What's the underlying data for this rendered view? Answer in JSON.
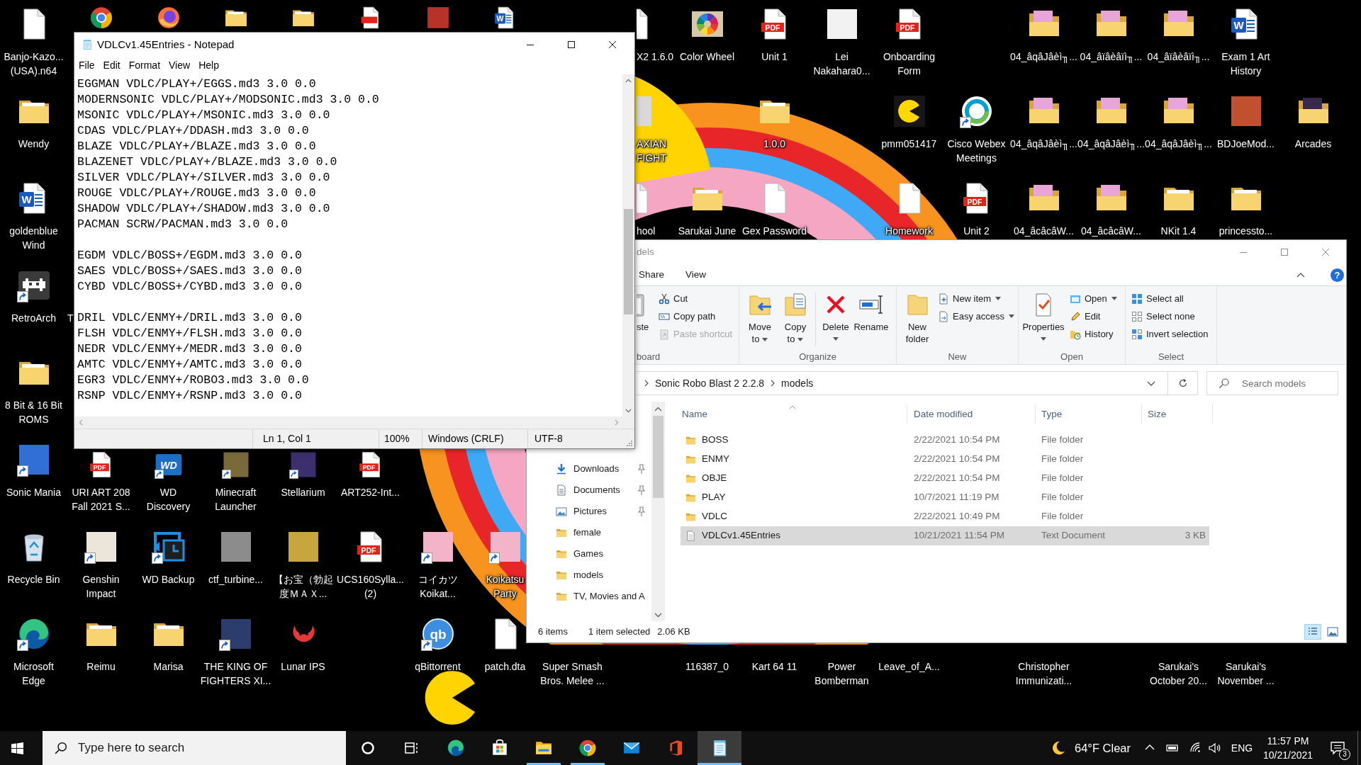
{
  "desktop": {
    "icons": [
      {
        "kind": "file",
        "label": "Banjo-Kazo...\n(USA).n64"
      },
      {
        "kind": "chrome"
      },
      {
        "kind": "firefox"
      },
      {
        "kind": "folder"
      },
      {
        "kind": "folder"
      },
      {
        "kind": "pdf"
      },
      {
        "kind": "picture",
        "color": "#b8322a"
      },
      {
        "kind": "word",
        "icon_text": "W"
      },
      {
        "kind": "file",
        "label": "X2 1.6.0"
      },
      {
        "kind": "colorwheel",
        "label": "Color Wheel"
      },
      {
        "kind": "pdf",
        "icon_text": "PDF",
        "label": "Unit 1"
      },
      {
        "kind": "picture",
        "color": "#f2f2f2",
        "label": "Lei\nNakahara0..."
      },
      {
        "kind": "pdf",
        "icon_text": "PDF",
        "label": "Onboarding\nForm"
      },
      {
        "kind": "imagefolder",
        "color": "#e8a6d6",
        "label": "04_âqâJâèì╖..."
      },
      {
        "kind": "imagefolder",
        "color": "#e8a6d6",
        "label": "04_âïâèâïì╖..."
      },
      {
        "kind": "imagefolder",
        "color": "#e8a6d6",
        "label": "04_âïâèâïì╖..."
      },
      {
        "kind": "word",
        "icon_text": "W",
        "label": "Exam 1 Art\nHistory"
      },
      {
        "kind": "folder",
        "label": "Wendy"
      },
      {
        "kind": "picture",
        "color": "#d9d9d9",
        "label": "AXIAN\nFIGHT"
      },
      {
        "kind": "folder",
        "label": "1.0.0"
      },
      {
        "kind": "pacman",
        "label": "pmm051417"
      },
      {
        "kind": "webex",
        "shortcut": true,
        "label": "Cisco Webex\nMeetings"
      },
      {
        "kind": "imagefolder",
        "color": "#e8a6d6",
        "label": "04_âqâJâèì╖..."
      },
      {
        "kind": "imagefolder",
        "color": "#e8a6d6",
        "label": "04_âqâJâèì╖..."
      },
      {
        "kind": "imagefolder",
        "color": "#e8a6d6",
        "label": "04_âqâJâèì╖..."
      },
      {
        "kind": "picture",
        "color": "#c0502e",
        "label": "BDJoeMod..."
      },
      {
        "kind": "imagefolder",
        "color": "#3a2a4a",
        "label": "Arcades"
      },
      {
        "kind": "word",
        "icon_text": "W",
        "label": "goldenblue\nWind"
      },
      {
        "kind": "file",
        "label": "hool"
      },
      {
        "kind": "folder",
        "label": "Sarukai June"
      },
      {
        "kind": "file",
        "label": "Gex Password"
      },
      {
        "kind": "file",
        "label": "Homework"
      },
      {
        "kind": "pdf",
        "icon_text": "PDF",
        "label": "Unit 2"
      },
      {
        "kind": "imagefolder",
        "color": "#e8a6d6",
        "label": "04_âcâcâW..."
      },
      {
        "kind": "imagefolder",
        "color": "#e8a6d6",
        "label": "04_âcâcâW..."
      },
      {
        "kind": "folder",
        "label": "NKit 1.4"
      },
      {
        "kind": "folder",
        "label": "princessto..."
      },
      {
        "kind": "retroarch",
        "shortcut": true,
        "label": "RetroArch"
      },
      {
        "label": "T"
      },
      {
        "kind": "folder",
        "label": "8 Bit & 16 Bit\nROMS"
      },
      {
        "kind": "picture",
        "color": "#2f6fd6",
        "shortcut": true,
        "label": "Sonic Mania"
      },
      {
        "kind": "pdf",
        "icon_text": "PDF",
        "label": "URI ART 208\nFall 2021 S..."
      },
      {
        "kind": "wd",
        "icon_text": "WD",
        "shortcut": true,
        "label": "WD\nDiscovery"
      },
      {
        "kind": "picture",
        "color": "#7a6a3a",
        "shortcut": true,
        "label": "Minecraft\nLauncher"
      },
      {
        "kind": "picture",
        "color": "#3b2f6e",
        "shortcut": true,
        "label": "Stellarium"
      },
      {
        "kind": "pdf",
        "icon_text": "PDF",
        "label": "ART252-Int..."
      },
      {
        "kind": "recyclebin",
        "label": "Recycle Bin"
      },
      {
        "kind": "picture",
        "color": "#ece6da",
        "shortcut": true,
        "label": "Genshin\nImpact"
      },
      {
        "kind": "wdbackup",
        "shortcut": true,
        "label": "WD Backup"
      },
      {
        "kind": "picture",
        "color": "#8c8c8c",
        "label": "ctf_turbine..."
      },
      {
        "kind": "picture",
        "color": "#c7a640",
        "label": "【お宝（勃起度ＭＡＸ..."
      },
      {
        "kind": "pdf",
        "icon_text": "PDF",
        "label": "UCS160Sylla...\n(2)"
      },
      {
        "kind": "picture",
        "color": "#f3b3c8",
        "shortcut": true,
        "label": "コイカツ\nKoikat..."
      },
      {
        "kind": "picture",
        "color": "#f3b3c8",
        "shortcut": true,
        "label": "Koikatsu\nParty"
      },
      {
        "kind": "edge",
        "shortcut": true,
        "label": "Microsoft\nEdge"
      },
      {
        "kind": "folder",
        "label": "Reimu"
      },
      {
        "kind": "folder",
        "label": "Marisa"
      },
      {
        "kind": "picture",
        "color": "#2c3c6c",
        "shortcut": true,
        "label": "THE KING OF\nFIGHTERS XI..."
      },
      {
        "kind": "lunar",
        "label": "Lunar IPS"
      },
      {
        "kind": "qbittorrent",
        "icon_text": "qb",
        "shortcut": true,
        "label": "qBittorrent"
      },
      {
        "kind": "file",
        "label": "patch.dta"
      },
      {
        "label": "Super Smash\nBros. Melee ..."
      },
      {
        "label": "116387_0"
      },
      {
        "label": "Kart 64 11"
      },
      {
        "label": "Power\nBomberman"
      },
      {
        "label": "Leave_of_A..."
      },
      {
        "label": "Christopher\nImmunizati..."
      },
      {
        "label": "Sarukai's\nOctober 20..."
      },
      {
        "label": "Sarukai's\nNovember ..."
      }
    ]
  },
  "notepad": {
    "title": "VDLCv1.45Entries - Notepad",
    "menu": [
      "File",
      "Edit",
      "Format",
      "View",
      "Help"
    ],
    "blocks": [
      [
        "EGGMAN VDLC/PLAY+/EGGS.md3 3.0 0.0",
        "MODERNSONIC VDLC/PLAY+/MODSONIC.md3 3.0 0.0",
        "MSONIC VDLC/PLAY+/MSONIC.md3 3.0 0.0",
        "CDAS VDLC/PLAY+/DDASH.md3 3.0 0.0",
        "BLAZE VDLC/PLAY+/BLAZE.md3 3.0 0.0",
        "BLAZENET VDLC/PLAY+/BLAZE.md3 3.0 0.0",
        "SILVER VDLC/PLAY+/SILVER.md3 3.0 0.0",
        "ROUGE VDLC/PLAY+/ROUGE.md3 3.0 0.0",
        "SHADOW VDLC/PLAY+/SHADOW.md3 3.0 0.0",
        "PACMAN SCRW/PACMAN.md3 3.0 0.0"
      ],
      [
        "EGDM VDLC/BOSS+/EGDM.md3 3.0 0.0",
        "SAES VDLC/BOSS+/SAES.md3 3.0 0.0",
        "CYBD VDLC/BOSS+/CYBD.md3 3.0 0.0"
      ],
      [
        "DRIL VDLC/ENMY+/DRIL.md3 3.0 0.0",
        "FLSH VDLC/ENMY+/FLSH.md3 3.0 0.0",
        "NEDR VDLC/ENMY+/MEDR.md3 3.0 0.0",
        "AMTC VDLC/ENMY+/AMTC.md3 3.0 0.0",
        "EGR3 VDLC/ENMY+/ROBO3.md3 3.0 0.0",
        "RSNP VDLC/ENMY+/RSNP.md3 3.0 0.0"
      ]
    ],
    "status": [
      "Ln 1, Col 1",
      "100%",
      "Windows (CRLF)",
      "UTF-8"
    ]
  },
  "explorer": {
    "title": "dels",
    "tabs": [
      {
        "label": "Share",
        "selected": false
      },
      {
        "label": "View",
        "selected": false
      }
    ],
    "help": "?",
    "ribbon": [
      {
        "label": "board",
        "large": [
          {
            "label": "ste",
            "kind": "paste"
          }
        ],
        "small": [
          {
            "label": "Cut",
            "kind": "cut",
            "disabled": false
          },
          {
            "label": "Copy path",
            "kind": "copypath",
            "disabled": false
          },
          {
            "label": "Paste shortcut",
            "kind": "pasteshortcut",
            "disabled": true
          }
        ]
      },
      {
        "label": "Organize",
        "large": [
          {
            "label": "Move\nto",
            "kind": "move",
            "dropdown": true
          },
          {
            "label": "Copy\nto",
            "kind": "copy",
            "dropdown": true
          },
          {
            "label": "Delete",
            "kind": "delete",
            "dropdown": true
          },
          {
            "label": "Rename",
            "kind": "rename"
          }
        ]
      },
      {
        "label": "New",
        "large": [
          {
            "label": "New\nfolder",
            "kind": "newfolder"
          }
        ],
        "small": [
          {
            "label": "New item",
            "kind": "newitem",
            "dropdown": true,
            "disabled": false
          },
          {
            "label": "Easy access",
            "kind": "easyaccess",
            "dropdown": true,
            "disabled": false
          }
        ]
      },
      {
        "label": "Open",
        "large": [
          {
            "label": "Properties",
            "kind": "properties",
            "dropdown": true
          }
        ],
        "small": [
          {
            "label": "Open",
            "kind": "open",
            "dropdown": true,
            "disabled": false
          },
          {
            "label": "Edit",
            "kind": "edit",
            "disabled": false
          },
          {
            "label": "History",
            "kind": "history",
            "disabled": false
          }
        ]
      },
      {
        "label": "Select",
        "small": [
          {
            "label": "Select all",
            "kind": "selectall",
            "disabled": false
          },
          {
            "label": "Select none",
            "kind": "selectnone",
            "disabled": false
          },
          {
            "label": "Invert selection",
            "kind": "invert",
            "disabled": false
          }
        ]
      }
    ],
    "address": [
      "Sonic Robo Blast 2 2.2.8",
      "models"
    ],
    "search": {
      "placeholder": "Search models"
    },
    "nav": [
      {
        "label": "Downloads",
        "kind": "downloads",
        "pinned": true
      },
      {
        "label": "Documents",
        "kind": "documents",
        "pinned": true
      },
      {
        "label": "Pictures",
        "kind": "pictures",
        "pinned": true
      },
      {
        "label": "female",
        "kind": "folder",
        "pinned": false
      },
      {
        "label": "Games",
        "kind": "folder",
        "pinned": false
      },
      {
        "label": "models",
        "kind": "folder",
        "pinned": false
      },
      {
        "label": "TV, Movies and A",
        "kind": "folder",
        "pinned": false
      }
    ],
    "columns": [
      "Name",
      "Date modified",
      "Type",
      "Size"
    ],
    "rows": [
      {
        "name": "BOSS",
        "kind": "folder",
        "date": "2/22/2021 10:54 PM",
        "type": "File folder",
        "selected": false
      },
      {
        "name": "ENMY",
        "kind": "folder",
        "date": "2/22/2021 10:54 PM",
        "type": "File folder",
        "selected": false
      },
      {
        "name": "OBJE",
        "kind": "folder",
        "date": "2/22/2021 10:54 PM",
        "type": "File folder",
        "selected": false
      },
      {
        "name": "PLAY",
        "kind": "folder",
        "date": "10/7/2021 11:19 PM",
        "type": "File folder",
        "selected": false
      },
      {
        "name": "VDLC",
        "kind": "folder",
        "date": "2/22/2021 10:49 PM",
        "type": "File folder",
        "selected": false
      },
      {
        "name": "VDLCv1.45Entries",
        "kind": "text",
        "date": "10/21/2021 11:54 PM",
        "type": "Text Document",
        "size": "3 KB",
        "selected": true
      }
    ],
    "status": {
      "items": "6 items",
      "selection": "1 item selected",
      "size": "2.06 KB"
    },
    "views": [
      {
        "kind": "details",
        "selected": true
      },
      {
        "kind": "tiles",
        "selected": false
      }
    ]
  },
  "taskbar": {
    "left": [
      {
        "kind": "start"
      },
      {
        "kind": "search",
        "placeholder": "Type here to search"
      },
      {
        "kind": "cortana"
      },
      {
        "kind": "taskview"
      }
    ],
    "apps": [
      {
        "kind": "edge",
        "running": false,
        "selected": false
      },
      {
        "kind": "store",
        "running": false,
        "selected": false
      },
      {
        "kind": "explorer",
        "running": true,
        "selected": false
      },
      {
        "kind": "chrome",
        "running": true,
        "selected": false
      },
      {
        "kind": "mail",
        "running": false,
        "selected": false
      },
      {
        "kind": "office",
        "running": false,
        "selected": false
      },
      {
        "kind": "notepad",
        "running": true,
        "selected": true
      }
    ],
    "weather": "64°F Clear",
    "tray": [
      {
        "kind": "chevron"
      },
      {
        "kind": "battery"
      },
      {
        "kind": "wifi"
      },
      {
        "kind": "volume"
      }
    ],
    "language": "ENG",
    "time": "11:57 PM",
    "date": "10/21/2021",
    "notifications": "3"
  }
}
